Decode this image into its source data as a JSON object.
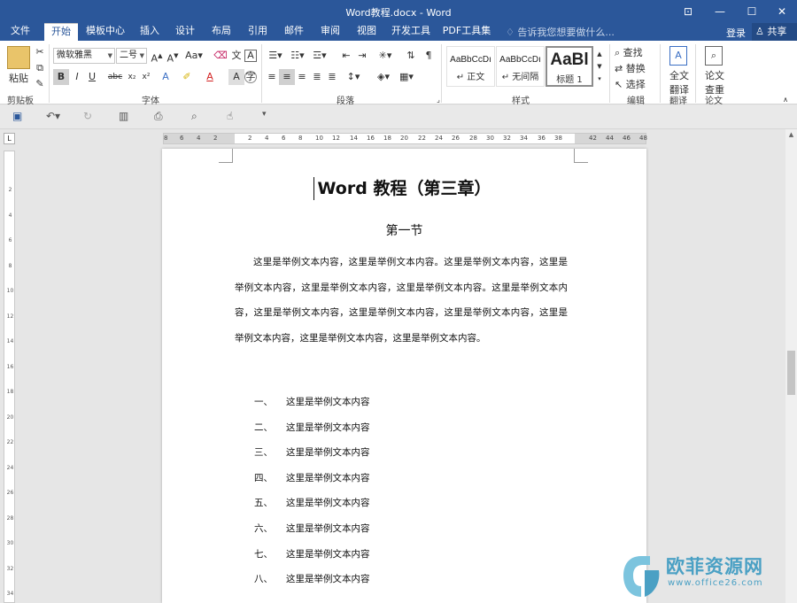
{
  "window": {
    "title": "Word教程.docx - Word",
    "minimize": "—",
    "maximize": "☐",
    "close": "✕",
    "restore": "⊡"
  },
  "tabs": [
    "文件",
    "开始",
    "模板中心",
    "插入",
    "设计",
    "布局",
    "引用",
    "邮件",
    "审阅",
    "视图",
    "开发工具",
    "PDF工具集"
  ],
  "active_tab": "开始",
  "tell_me": "告诉我您想要做什么...",
  "login": "登录",
  "share": "共享",
  "ribbon": {
    "clipboard": {
      "paste": "粘贴",
      "label": "剪贴板"
    },
    "font": {
      "name": "微软雅黑",
      "size": "二号",
      "label": "字体"
    },
    "paragraph": {
      "label": "段落"
    },
    "styles": {
      "label": "样式",
      "items": [
        {
          "sample": "AaBbCcDı",
          "name": "↵ 正文"
        },
        {
          "sample": "AaBbCcDı",
          "name": "↵ 无间隔"
        },
        {
          "sample": "AaBl",
          "name": "标题 1"
        }
      ]
    },
    "editing": {
      "find": "查找",
      "replace": "替换",
      "select": "选择",
      "label": "编辑"
    },
    "translate": {
      "line1": "全文",
      "line2": "翻译",
      "label": "翻译"
    },
    "paper": {
      "line1": "论文",
      "line2": "查重",
      "label": "论文"
    }
  },
  "ruler_ticks": [
    "8",
    "6",
    "4",
    "2",
    "2",
    "4",
    "6",
    "8",
    "10",
    "12",
    "14",
    "16",
    "18",
    "20",
    "22",
    "24",
    "26",
    "28",
    "30",
    "32",
    "34",
    "36",
    "38",
    "42",
    "44",
    "46",
    "48"
  ],
  "vruler_ticks": [
    "2",
    "4",
    "6",
    "8",
    "10",
    "12",
    "14",
    "16",
    "18",
    "20",
    "22",
    "24",
    "26",
    "28",
    "30",
    "32",
    "34"
  ],
  "document": {
    "title": "Word 教程（第三章）",
    "section": "第一节",
    "paragraph": "这里是举例文本内容，这里是举例文本内容。这里是举例文本内容，这里是举例文本内容，这里是举例文本内容，这里是举例文本内容。这里是举例文本内容，这里是举例文本内容，这里是举例文本内容，这里是举例文本内容，这里是举例文本内容，这里是举例文本内容，这里是举例文本内容。",
    "list": [
      {
        "num": "一、",
        "text": "这里是举例文本内容"
      },
      {
        "num": "二、",
        "text": "这里是举例文本内容"
      },
      {
        "num": "三、",
        "text": "这里是举例文本内容"
      },
      {
        "num": "四、",
        "text": "这里是举例文本内容"
      },
      {
        "num": "五、",
        "text": "这里是举例文本内容"
      },
      {
        "num": "六、",
        "text": "这里是举例文本内容"
      },
      {
        "num": "七、",
        "text": "这里是举例文本内容"
      },
      {
        "num": "八、",
        "text": "这里是举例文本内容"
      }
    ]
  },
  "watermark": {
    "name": "欧菲资源网",
    "url": "www.office26.com"
  },
  "colors": {
    "brand": "#2b579a",
    "watermark": "#4aa0c4"
  }
}
